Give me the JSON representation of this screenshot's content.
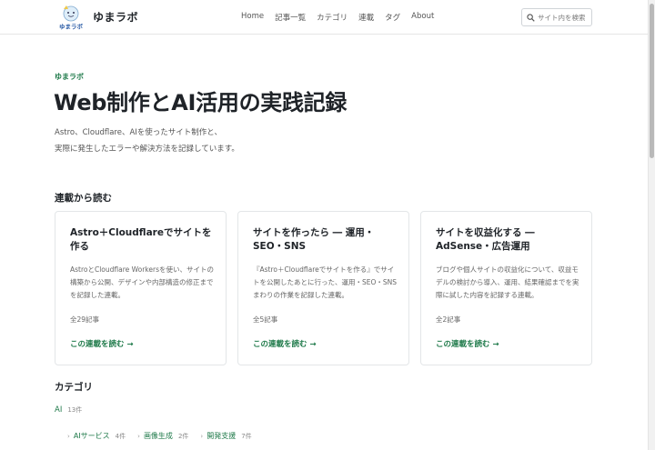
{
  "header": {
    "logo_text": "ゆまラボ",
    "site_name": "ゆまラボ",
    "nav": [
      "Home",
      "記事一覧",
      "カテゴリ",
      "連載",
      "タグ",
      "About"
    ],
    "search_placeholder": "サイト内を検索"
  },
  "hero": {
    "eyebrow": "ゆまラボ",
    "title": "Web制作とAI活用の実践記録",
    "desc_line1": "Astro、Cloudflare、AIを使ったサイト制作と、",
    "desc_line2": "実際に発生したエラーや解決方法を記録しています。"
  },
  "series": {
    "heading": "連載から読む",
    "cards": [
      {
        "title": "Astro＋Cloudflareでサイトを作る",
        "desc": "AstroとCloudflare Workersを使い、サイトの構築から公開、デザインや内部構造の修正までを記録した連載。",
        "count": "全29記事",
        "link": "この連載を読む →"
      },
      {
        "title": "サイトを作ったら ― 運用・SEO・SNS",
        "desc": "『Astro＋Cloudflareでサイトを作る』でサイトを公開したあとに行った、運用・SEO・SNSまわりの作業を記録した連載。",
        "count": "全5記事",
        "link": "この連載を読む →"
      },
      {
        "title": "サイトを収益化する ― AdSense・広告運用",
        "desc": "ブログや個人サイトの収益化について、収益モデルの検討から導入、運用、結果確認までを実際に試した内容を記録する連載。",
        "count": "全2記事",
        "link": "この連載を読む →"
      }
    ]
  },
  "categories": {
    "heading": "カテゴリ",
    "main": {
      "label": "AI",
      "count": "13件"
    },
    "subs": [
      {
        "label": "AIサービス",
        "count": "4件"
      },
      {
        "label": "画像生成",
        "count": "2件"
      },
      {
        "label": "開発支援",
        "count": "7件"
      }
    ]
  },
  "colors": {
    "accent": "#1f7a4a",
    "text": "#1f2328",
    "muted": "#666666"
  }
}
